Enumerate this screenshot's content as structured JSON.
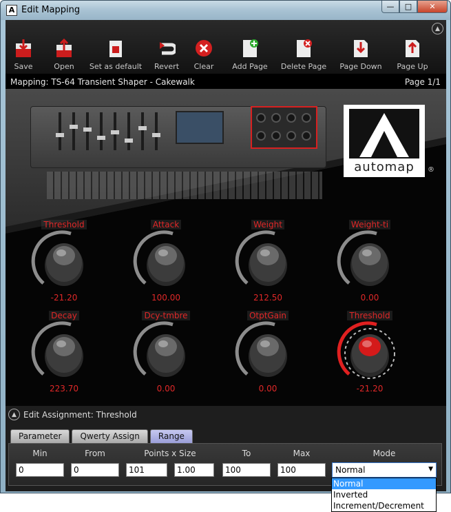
{
  "window": {
    "title": "Edit Mapping",
    "app_icon_letter": "A"
  },
  "toolbar": {
    "items": [
      {
        "label": "Save",
        "icon": "save-icon"
      },
      {
        "label": "Open",
        "icon": "open-icon"
      },
      {
        "label": "Set as default",
        "icon": "set-default-icon"
      },
      {
        "label": "Revert",
        "icon": "revert-icon"
      },
      {
        "label": "Clear",
        "icon": "clear-icon"
      },
      {
        "label": "Add Page",
        "icon": "add-page-icon"
      },
      {
        "label": "Delete Page",
        "icon": "delete-page-icon"
      },
      {
        "label": "Page Down",
        "icon": "page-down-icon"
      },
      {
        "label": "Page Up",
        "icon": "page-up-icon"
      }
    ]
  },
  "mapping": {
    "title": "Mapping: TS-64 Transient Shaper - Cakewalk",
    "page": "Page 1/1"
  },
  "logo": {
    "text": "automap",
    "reg": "®"
  },
  "knobs": [
    {
      "name": "Threshold",
      "value": "-21.20",
      "selected": false
    },
    {
      "name": "Attack",
      "value": "100.00",
      "selected": false
    },
    {
      "name": "Weight",
      "value": "212.50",
      "selected": false
    },
    {
      "name": "Weight-ti",
      "value": "0.00",
      "selected": false
    },
    {
      "name": "Decay",
      "value": "223.70",
      "selected": false
    },
    {
      "name": "Dcy-tmbre",
      "value": "0.00",
      "selected": false
    },
    {
      "name": "OtptGain",
      "value": "0.00",
      "selected": false
    },
    {
      "name": "Threshold",
      "value": "-21.20",
      "selected": true
    }
  ],
  "edit": {
    "heading": "Edit Assignment: Threshold",
    "tabs": [
      "Parameter",
      "Qwerty Assign",
      "Range"
    ],
    "active_tab": "Range",
    "range": {
      "headers": [
        "Min",
        "From",
        "Points x Size",
        "To",
        "Max",
        "Mode"
      ],
      "min": "0",
      "from": "0",
      "points": "101",
      "size": "1.00",
      "to": "100",
      "max": "100",
      "mode": "Normal"
    },
    "mode_options": [
      "Normal",
      "Inverted",
      "Increment/Decrement"
    ]
  },
  "colors": {
    "accent_red": "#e02828",
    "selection_blue": "#3399ff"
  }
}
